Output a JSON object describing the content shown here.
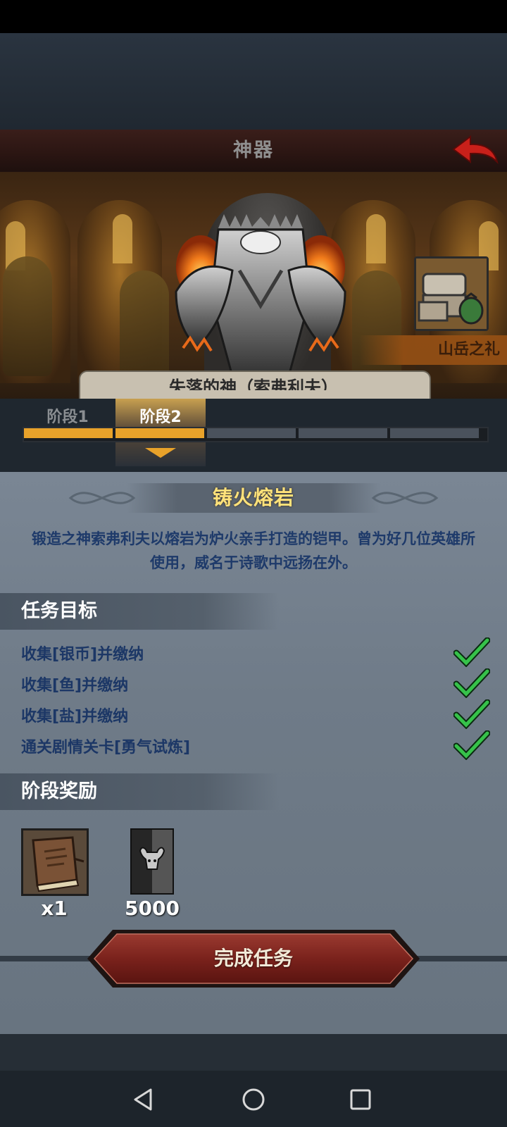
{
  "header": {
    "title": "神器"
  },
  "scene": {
    "gift_label": "山岳之礼",
    "character_name": "失落的神（索弗利夫）"
  },
  "stages": {
    "tabs": [
      {
        "label": "阶段1"
      },
      {
        "label": "阶段2"
      }
    ],
    "total_segments": 5,
    "completed_segments": 2,
    "current_stage": 2
  },
  "artifact": {
    "title": "铸火熔岩",
    "description": "锻造之神索弗利夫以熔岩为炉火亲手打造的铠甲。曾为好几位英雄所使用，威名于诗歌中远扬在外。"
  },
  "tasks": {
    "heading": "任务目标",
    "items": [
      {
        "label": "收集[银币]并缴纳",
        "done": true
      },
      {
        "label": "收集[鱼]并缴纳",
        "done": true
      },
      {
        "label": "收集[盐]并缴纳",
        "done": true
      },
      {
        "label": "通关剧情关卡[勇气试炼]",
        "done": true
      }
    ]
  },
  "rewards": {
    "heading": "阶段奖励",
    "items": [
      {
        "icon": "book-icon",
        "qty": "x1"
      },
      {
        "icon": "bull-token-icon",
        "qty": "5000"
      }
    ]
  },
  "complete_button": {
    "label": "完成任务"
  },
  "colors": {
    "accent": "#e8a22a",
    "task_text": "#1c3766",
    "title_gold": "#ffe27a",
    "check_green": "#36c24a"
  }
}
